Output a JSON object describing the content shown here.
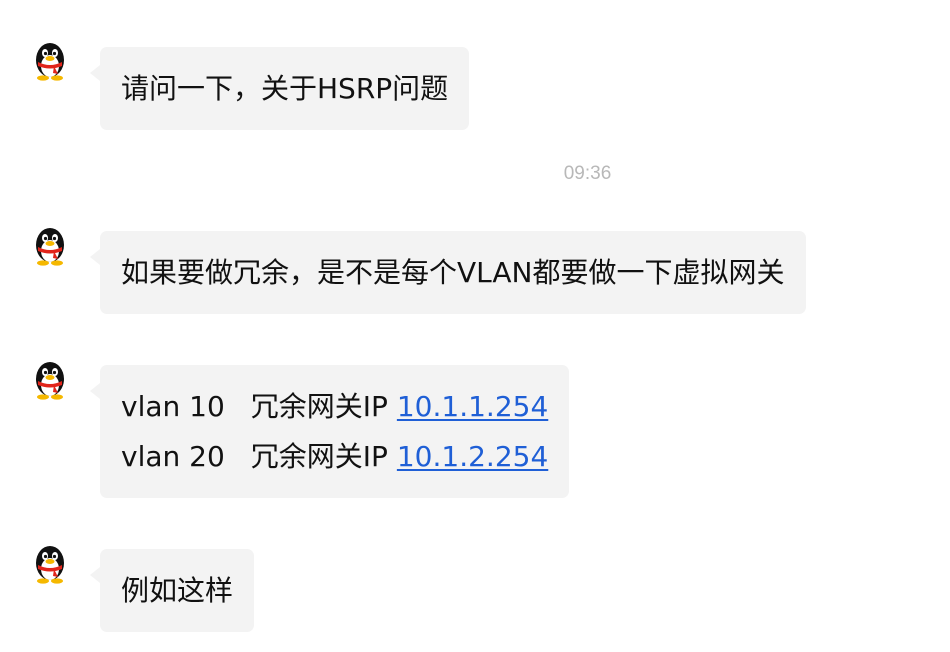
{
  "messages": [
    {
      "text": "请问一下，关于HSRP问题"
    },
    {
      "text": "如果要做冗余，是不是每个VLAN都要做一下虚拟网关"
    },
    {
      "lines": [
        {
          "vlan": "vlan 10",
          "label": "冗余网关IP",
          "ip": "10.1.1.254"
        },
        {
          "vlan": "vlan 20",
          "label": "冗余网关IP",
          "ip": "10.1.2.254"
        }
      ]
    },
    {
      "text": "例如这样"
    }
  ],
  "timestamp": "09:36",
  "colors": {
    "bubble": "#f3f3f3",
    "link": "#1f5fd6",
    "timestamp": "#b8b8b8"
  },
  "icons": {
    "avatar": "qq-penguin-avatar-icon"
  }
}
